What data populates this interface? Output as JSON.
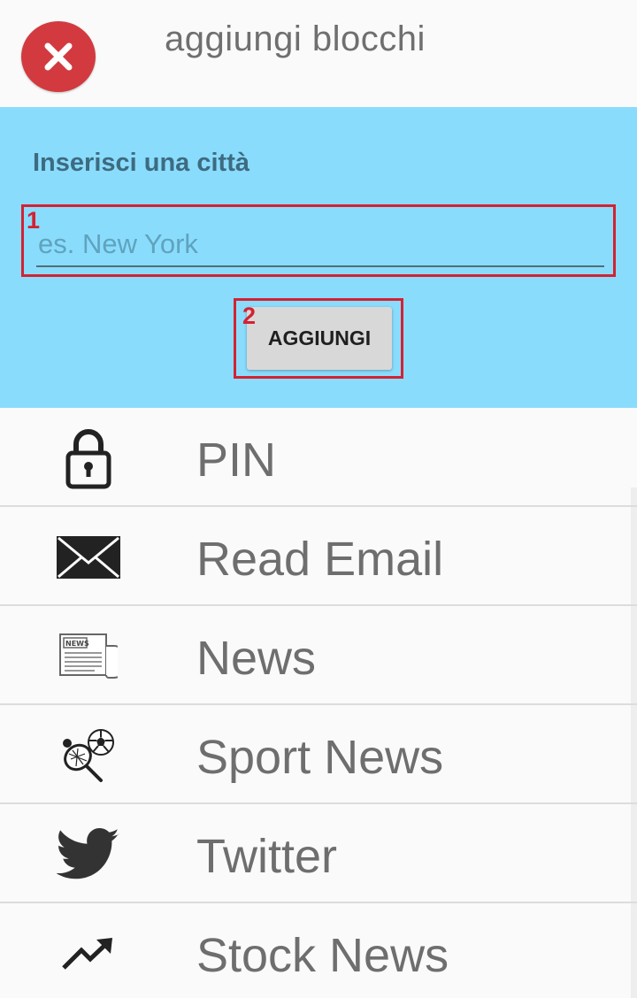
{
  "header": {
    "title": "aggiungi blocchi",
    "close_icon": "close-icon",
    "close_color": "#d23a3f"
  },
  "form": {
    "label": "Inserisci una città",
    "input_value": "",
    "input_placeholder": "es. New York",
    "add_button_label": "AGGIUNGI",
    "marker_input": "1",
    "marker_button": "2",
    "panel_color": "#8adcfd",
    "marker_color": "#d32233"
  },
  "blocks": [
    {
      "label": "PIN",
      "icon": "lock-icon"
    },
    {
      "label": "Read Email",
      "icon": "envelope-icon"
    },
    {
      "label": "News",
      "icon": "newspaper-icon",
      "icon_text": "NEWS"
    },
    {
      "label": "Sport News",
      "icon": "sports-icon"
    },
    {
      "label": "Twitter",
      "icon": "twitter-bird-icon"
    },
    {
      "label": "Stock News",
      "icon": "trending-up-icon"
    }
  ]
}
